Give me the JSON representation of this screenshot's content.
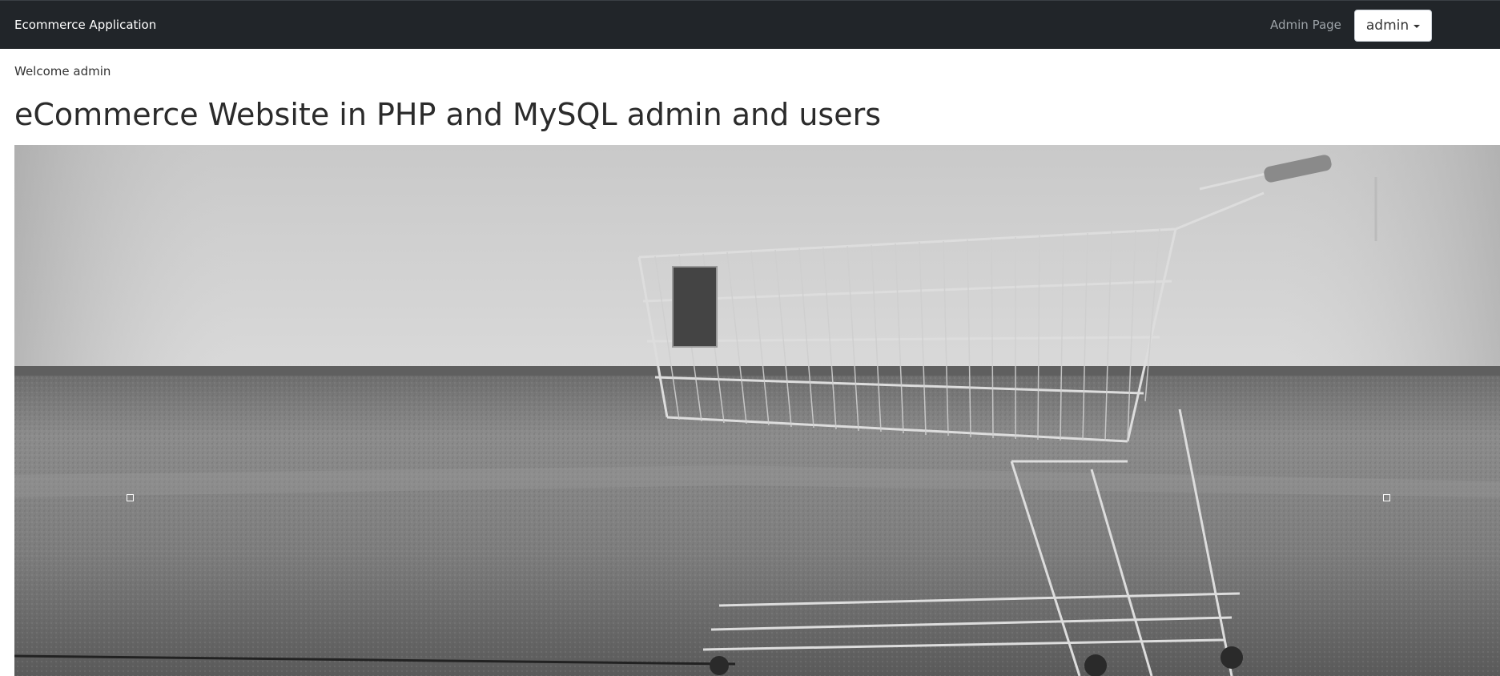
{
  "navbar": {
    "brand": "Ecommerce Application",
    "admin_page_link": "Admin Page",
    "user_menu": {
      "label": "admin",
      "icon": "caret-down-icon"
    },
    "background_color": "#212529"
  },
  "main": {
    "welcome_text": "Welcome admin",
    "title": "eCommerce Website in PHP and MySQL admin and users",
    "hero_image": {
      "subject": "shopping-cart-photo",
      "style": "grayscale"
    }
  }
}
